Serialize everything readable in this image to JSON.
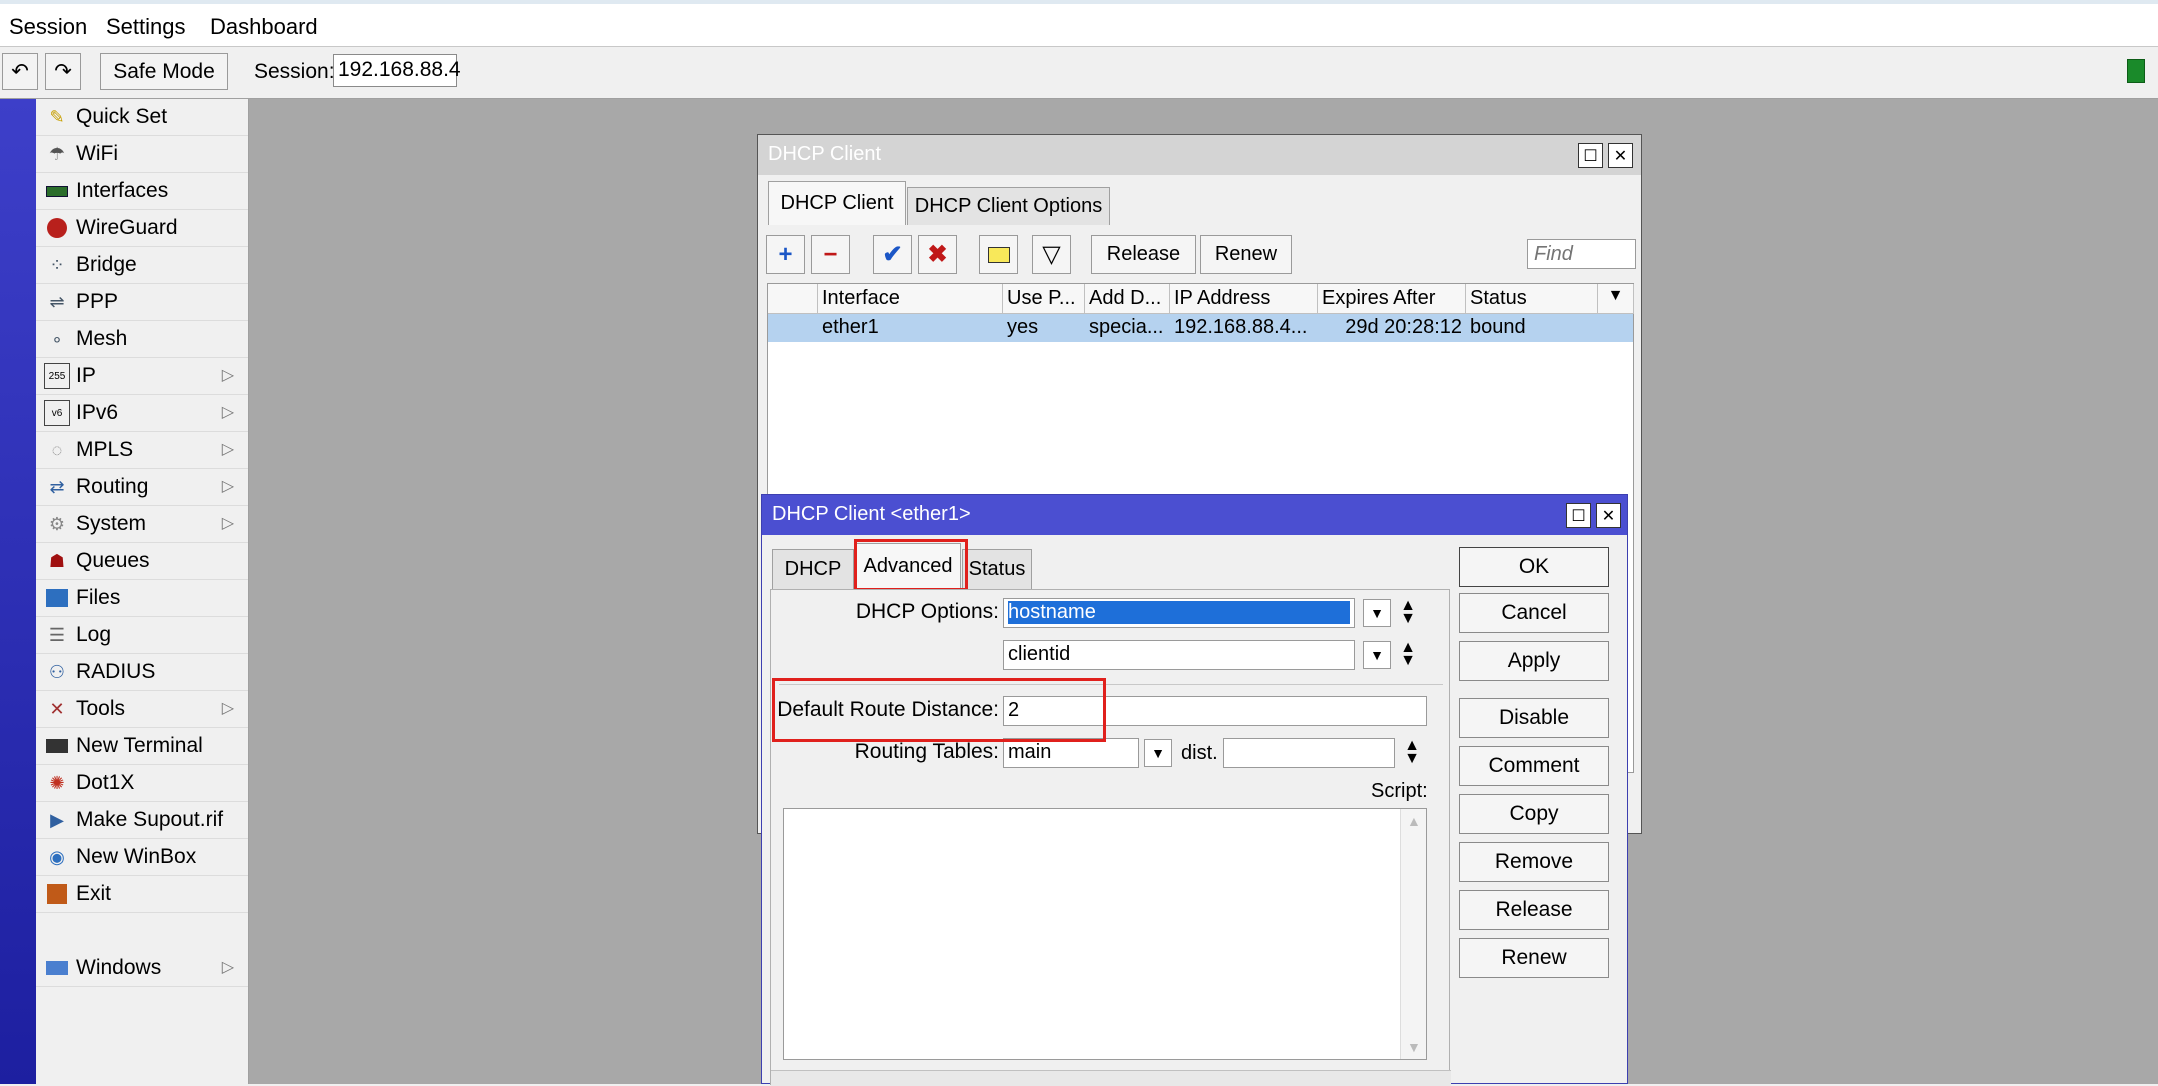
{
  "menubar": {
    "items": [
      "Session",
      "Settings",
      "Dashboard"
    ]
  },
  "toolbar": {
    "undo_icon": "undo-icon",
    "redo_icon": "redo-icon",
    "safe_mode": "Safe Mode",
    "session_label": "Session:",
    "session_value": "192.168.88.4"
  },
  "sidebar": {
    "items": [
      {
        "label": "Quick Set",
        "icon": "quick-set-icon"
      },
      {
        "label": "WiFi",
        "icon": "wifi-icon"
      },
      {
        "label": "Interfaces",
        "icon": "interfaces-icon"
      },
      {
        "label": "WireGuard",
        "icon": "wireguard-icon"
      },
      {
        "label": "Bridge",
        "icon": "bridge-icon"
      },
      {
        "label": "PPP",
        "icon": "ppp-icon"
      },
      {
        "label": "Mesh",
        "icon": "mesh-icon"
      },
      {
        "label": "IP",
        "icon": "ip-icon"
      },
      {
        "label": "IPv6",
        "icon": "ipv6-icon"
      },
      {
        "label": "MPLS",
        "icon": "mpls-icon"
      },
      {
        "label": "Routing",
        "icon": "routing-icon"
      },
      {
        "label": "System",
        "icon": "system-icon"
      },
      {
        "label": "Queues",
        "icon": "queues-icon"
      },
      {
        "label": "Files",
        "icon": "files-icon"
      },
      {
        "label": "Log",
        "icon": "log-icon"
      },
      {
        "label": "RADIUS",
        "icon": "radius-icon"
      },
      {
        "label": "Tools",
        "icon": "tools-icon"
      },
      {
        "label": "New Terminal",
        "icon": "terminal-icon"
      },
      {
        "label": "Dot1X",
        "icon": "dot1x-icon"
      },
      {
        "label": "Make Supout.rif",
        "icon": "supout-icon"
      },
      {
        "label": "New WinBox",
        "icon": "winbox-icon"
      },
      {
        "label": "Exit",
        "icon": "exit-icon"
      },
      {
        "label": "Windows",
        "icon": "windows-icon"
      }
    ]
  },
  "dhcp_client_window": {
    "title": "DHCP Client",
    "tabs": [
      "DHCP Client",
      "DHCP Client Options"
    ],
    "buttons": {
      "release": "Release",
      "renew": "Renew"
    },
    "find_placeholder": "Find",
    "columns": [
      "Interface",
      "Use P...",
      "Add D...",
      "IP Address",
      "Expires After",
      "Status"
    ],
    "rows": [
      {
        "interface": "ether1",
        "use_peer": "yes",
        "add_default": "specia...",
        "ip": "192.168.88.4...",
        "expires": "29d 20:28:12",
        "status": "bound"
      }
    ]
  },
  "dhcp_dialog": {
    "title": "DHCP Client <ether1>",
    "tabs": [
      "DHCP",
      "Advanced",
      "Status"
    ],
    "dhcp_options_label": "DHCP Options:",
    "dhcp_option_1": "hostname",
    "dhcp_option_2": "clientid",
    "default_route_distance_label": "Default Route Distance:",
    "default_route_distance": "2",
    "routing_tables_label": "Routing Tables:",
    "routing_table": "main",
    "dist_label": "dist.",
    "dist_value": "",
    "script_label": "Script:",
    "script_value": "",
    "side_buttons": [
      "OK",
      "Cancel",
      "Apply",
      "Disable",
      "Comment",
      "Copy",
      "Remove",
      "Release",
      "Renew"
    ]
  },
  "colors": {
    "active_title": "#4b4fd1",
    "inactive_title": "#d4d4d4",
    "selected_row": "#b5d2ef",
    "highlight": "#e0201c"
  }
}
